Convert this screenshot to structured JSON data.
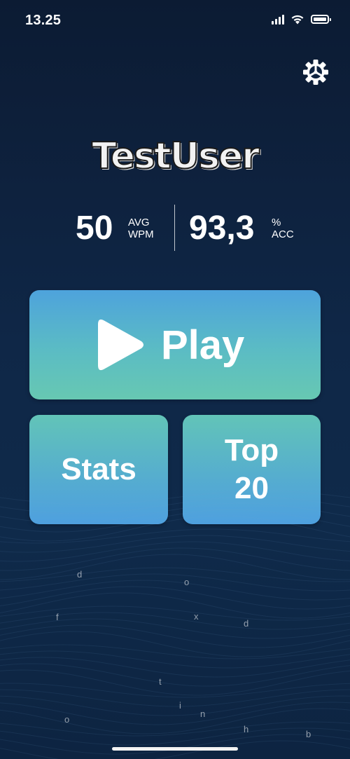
{
  "status_bar": {
    "time": "13.25"
  },
  "profile": {
    "username": "TestUser"
  },
  "stats": {
    "wpm_value": "50",
    "wpm_unit_line1": "AVG",
    "wpm_unit_line2": "WPM",
    "acc_value": "93,3",
    "acc_unit_line1": "%",
    "acc_unit_line2": "ACC"
  },
  "buttons": {
    "play_label": "Play",
    "stats_label": "Stats",
    "top20_line1": "Top",
    "top20_line2": "20"
  },
  "floating_letters": [
    "d",
    "o",
    "f",
    "x",
    "d",
    "t",
    "i",
    "n",
    "o",
    "h",
    "b"
  ],
  "icons": {
    "settings": "gear-icon",
    "play": "play-icon",
    "signal": "cellular-signal-icon",
    "wifi": "wifi-icon",
    "battery": "battery-icon"
  },
  "colors": {
    "background_top": "#0c1b33",
    "background_bottom": "#0f2a4a",
    "play_gradient_top": "#4ea3dc",
    "play_gradient_bottom": "#67c8b2",
    "tile_gradient_top": "#62c4b8",
    "tile_gradient_bottom": "#4ea0df"
  }
}
